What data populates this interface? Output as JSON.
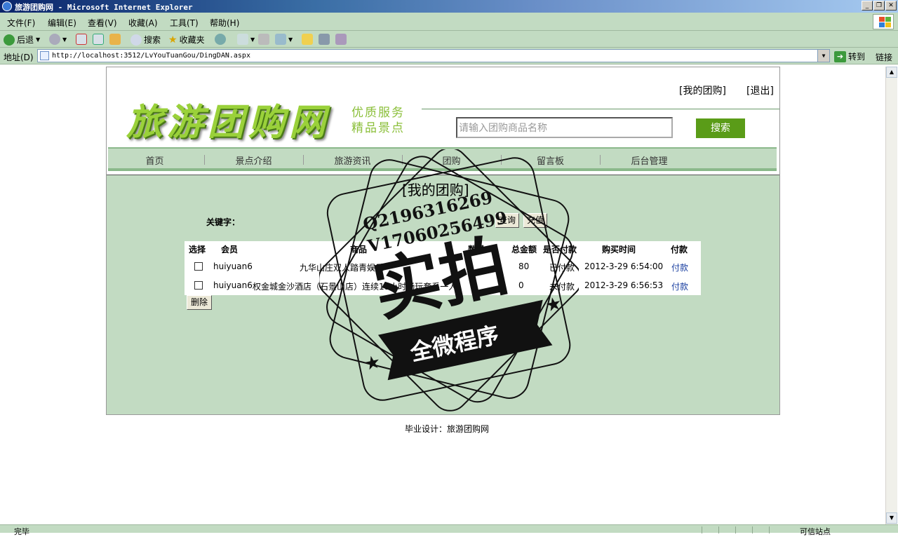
{
  "window": {
    "title": "旅游团购网 - Microsoft Internet Explorer",
    "buttons": [
      "_",
      "❐",
      "✕"
    ]
  },
  "menu": [
    "文件(F)",
    "编辑(E)",
    "查看(V)",
    "收藏(A)",
    "工具(T)",
    "帮助(H)"
  ],
  "toolbar": {
    "back": "后退",
    "search": "搜索",
    "favorites": "收藏夹"
  },
  "address": {
    "label": "地址(D)",
    "url": "http://localhost:3512/LvYouTuanGou/DingDAN.aspx",
    "go": "转到",
    "links": "链接"
  },
  "header": {
    "logo": "旅游团购网",
    "slogan_line1": "优质服务",
    "slogan_line2": "精品景点",
    "my_group": "[我的团购]",
    "logout": "[退出]",
    "search_placeholder": "请输入团购商品名称",
    "search_button": "搜索"
  },
  "nav": [
    "首页",
    "景点介绍",
    "旅游资讯",
    "团购",
    "留言板",
    "后台管理"
  ],
  "main": {
    "title": "[我的团购]",
    "keyword_label": "关键字：",
    "query_button": "查询",
    "recharge_button": "充值",
    "delete_button": "删除"
  },
  "table": {
    "headers": [
      "选择",
      "会员",
      "商品",
      "数量",
      "总金额",
      "是否付款",
      "购买时间",
      "付款"
    ],
    "rows": [
      {
        "member": "huiyuan6",
        "product": "九华山庄双人踏青娱乐",
        "total": "80",
        "paid": "已付款",
        "time": "2012-3-29 6:54:00",
        "pay": "付款"
      },
      {
        "member": "huiyuan6",
        "product": "权金城金沙酒店（石景山店）连续18小时畅玩套系一人",
        "total": "0",
        "paid": "未付款",
        "time": "2012-3-29 6:56:53",
        "pay": "付款"
      }
    ]
  },
  "footer": "毕业设计：旅游团购网",
  "status": {
    "left": "完毕",
    "zone": "可信站点"
  },
  "stamp": {
    "line1": "Q2196316269",
    "line2": "V17060256499",
    "big": "实拍",
    "banner": "全微程序"
  }
}
